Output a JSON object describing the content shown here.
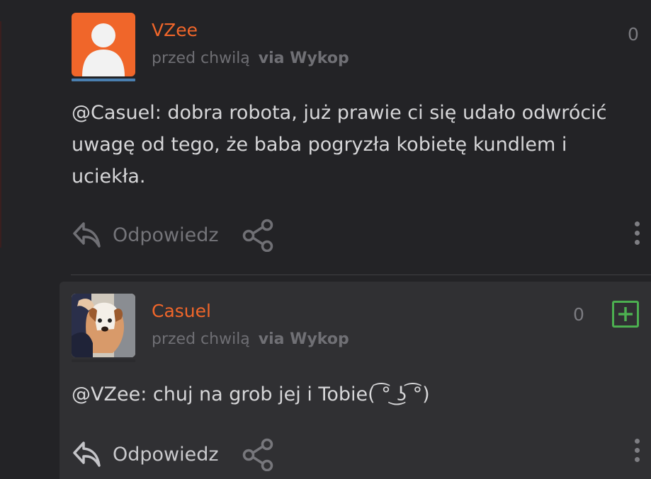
{
  "comments": [
    {
      "username": "VZee",
      "time": "przed chwilą",
      "via": "via Wykop",
      "score": "0",
      "text": "@Casuel: dobra robota, już prawie ci się udało odwrócić uwagę od tego, że baba pogryzła kobietę kundlem i uciekła.",
      "reply_label": "Odpowiedz",
      "avatar": "default-user-avatar"
    },
    {
      "username": "Casuel",
      "time": "przed chwilą",
      "via": "via Wykop",
      "score": "0",
      "text": "@VZee: chuj na grob jej i Tobie( ͡° ͜ʖ ͡°)",
      "reply_label": "Odpowiedz",
      "avatar": "dog-photo-avatar"
    }
  ],
  "colors": {
    "background": "#232326",
    "reply_background": "#303033",
    "accent_orange": "#f0662a",
    "plus_green": "#4caf50"
  },
  "icons": [
    "reply-icon",
    "share-icon",
    "more-options-icon",
    "plus-icon"
  ]
}
